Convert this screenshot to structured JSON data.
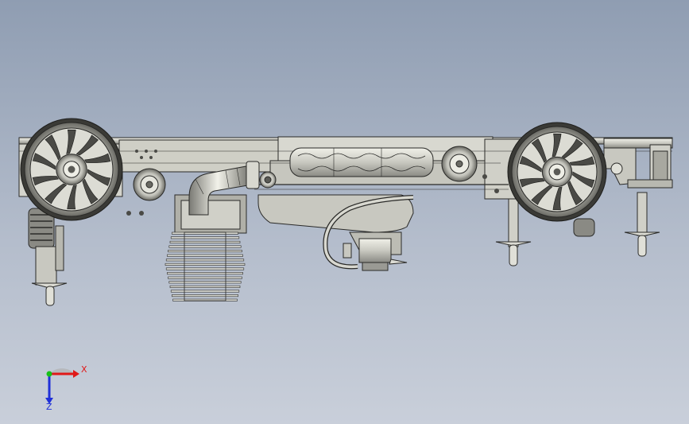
{
  "viewport": {
    "background_top": "#8f9db2",
    "background_bottom": "#c9cfda",
    "model_name": "",
    "model_description": ""
  },
  "triad": {
    "x_label": "X",
    "z_label": "Z",
    "x_color": "#e01818",
    "y_color": "#18c018",
    "z_color": "#2030d8"
  },
  "colors": {
    "metal_light": "#e8e8e0",
    "metal_mid": "#b8b8b0",
    "metal_dark": "#5a5a55",
    "line": "#2a2a28"
  }
}
